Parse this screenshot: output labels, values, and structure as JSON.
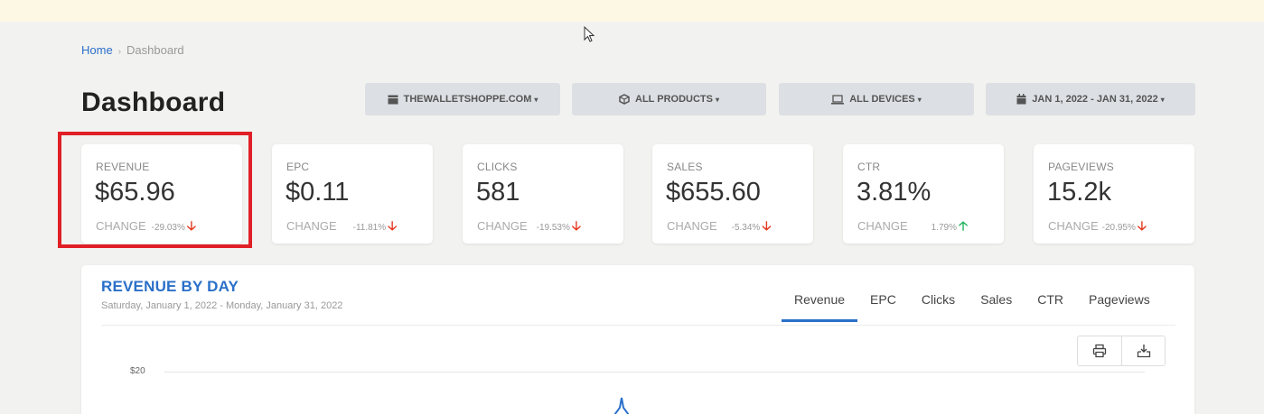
{
  "breadcrumb": {
    "home": "Home",
    "separator": "›",
    "current": "Dashboard"
  },
  "page": {
    "title": "Dashboard"
  },
  "filters": [
    {
      "icon": "store-icon",
      "label": "THEWALLETSHOPPE.COM"
    },
    {
      "icon": "cube-icon",
      "label": "ALL PRODUCTS"
    },
    {
      "icon": "laptop-icon",
      "label": "ALL DEVICES"
    },
    {
      "icon": "calendar-icon",
      "label": "JAN 1, 2022 - JAN 31, 2022"
    }
  ],
  "metrics": [
    {
      "label": "REVENUE",
      "value": "$65.96",
      "change_label": "CHANGE",
      "change": "-29.03%",
      "direction": "down"
    },
    {
      "label": "EPC",
      "value": "$0.11",
      "change_label": "CHANGE",
      "change": "-11.81%",
      "direction": "down"
    },
    {
      "label": "CLICKS",
      "value": "581",
      "change_label": "CHANGE",
      "change": "-19.53%",
      "direction": "down"
    },
    {
      "label": "SALES",
      "value": "$655.60",
      "change_label": "CHANGE",
      "change": "-5.34%",
      "direction": "down"
    },
    {
      "label": "CTR",
      "value": "3.81%",
      "change_label": "CHANGE",
      "change": "1.79%",
      "direction": "up"
    },
    {
      "label": "PAGEVIEWS",
      "value": "15.2k",
      "change_label": "CHANGE",
      "change": "-20.95%",
      "direction": "down"
    }
  ],
  "chart_panel": {
    "title": "REVENUE BY DAY",
    "subtitle": "Saturday, January 1, 2022 - Monday, January 31, 2022",
    "tabs": [
      "Revenue",
      "EPC",
      "Clicks",
      "Sales",
      "CTR",
      "Pageviews"
    ],
    "active_tab": "Revenue",
    "y_tick": "$20"
  },
  "colors": {
    "accent": "#2a6fc9",
    "down": "#e53a20",
    "up": "#28b463",
    "highlight": "#e01f26"
  }
}
